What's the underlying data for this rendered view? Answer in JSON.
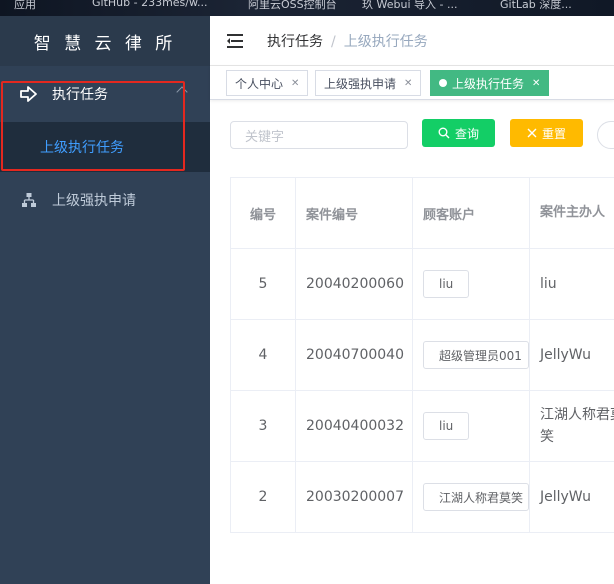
{
  "browser": {
    "bookmarks": [
      "应用",
      "GitHub - 233mes/w...",
      "阿里云OSS控制台",
      "玖 Webui 导入 - ...",
      "GitLab 深度..."
    ]
  },
  "sidebar": {
    "brand": "智 慧 云 律 所",
    "items": [
      {
        "label": "执行任务",
        "icon": "arrow-right-icon",
        "expanded": true
      },
      {
        "label": "上级强执申请",
        "icon": "sitemap-icon"
      }
    ],
    "submenu": [
      {
        "label": "上级执行任务",
        "active": true
      }
    ]
  },
  "navbar": {
    "breadcrumb": [
      "执行任务",
      "上级执行任务"
    ]
  },
  "tags": [
    {
      "label": "个人中心",
      "active": false
    },
    {
      "label": "上级强执申请",
      "active": false
    },
    {
      "label": "上级执行任务",
      "active": true
    }
  ],
  "toolbar": {
    "search_placeholder": "关键字",
    "query_label": "查询",
    "reset_label": "重置"
  },
  "table": {
    "columns": [
      "编号",
      "案件编号",
      "顾客账户",
      "案件主办人"
    ],
    "rows": [
      {
        "id": "5",
        "case_no": "20040200060",
        "account": "liu",
        "host": "liu"
      },
      {
        "id": "4",
        "case_no": "20040700040",
        "account": "超级管理员001",
        "host": "JellyWu"
      },
      {
        "id": "3",
        "case_no": "20040400032",
        "account": "liu",
        "host": "江湖人称君莫笑"
      },
      {
        "id": "2",
        "case_no": "20030200007",
        "account": "江湖人称君莫笑",
        "host": "JellyWu"
      }
    ]
  },
  "colors": {
    "sidebar_bg": "#304156",
    "submenu_bg": "#1f2d3d",
    "accent_blue": "#409eff",
    "tag_active": "#42b983",
    "query_btn": "#13ce66",
    "reset_btn": "#ffba00",
    "highlight_box": "#e4281f"
  }
}
